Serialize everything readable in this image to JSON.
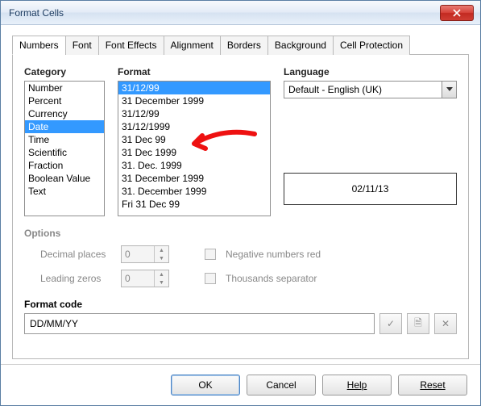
{
  "window": {
    "title": "Format Cells"
  },
  "tabs": [
    {
      "label": "Numbers",
      "active": true
    },
    {
      "label": "Font"
    },
    {
      "label": "Font Effects"
    },
    {
      "label": "Alignment"
    },
    {
      "label": "Borders"
    },
    {
      "label": "Background"
    },
    {
      "label": "Cell Protection"
    }
  ],
  "category": {
    "label": "Category",
    "items": [
      "Number",
      "Percent",
      "Currency",
      "Date",
      "Time",
      "Scientific",
      "Fraction",
      "Boolean Value",
      "Text"
    ],
    "selected": "Date"
  },
  "format": {
    "label": "Format",
    "items": [
      "31/12/99",
      "31 December 1999",
      "31/12/99",
      "31/12/1999",
      "31 Dec 99",
      "31 Dec 1999",
      "31. Dec. 1999",
      "31 December 1999",
      "31. December 1999",
      "Fri 31 Dec 99"
    ],
    "selected_index": 0
  },
  "language": {
    "label": "Language",
    "value": "Default - English (UK)"
  },
  "preview": {
    "value": "02/11/13"
  },
  "options": {
    "label": "Options",
    "decimal_label": "Decimal places",
    "decimal_value": "0",
    "leading_label": "Leading zeros",
    "leading_value": "0",
    "neg_label": "Negative numbers red",
    "thou_label": "Thousands separator"
  },
  "format_code": {
    "label": "Format code",
    "value": "DD/MM/YY"
  },
  "buttons": {
    "ok": "OK",
    "cancel": "Cancel",
    "help": "Help",
    "reset": "Reset"
  }
}
